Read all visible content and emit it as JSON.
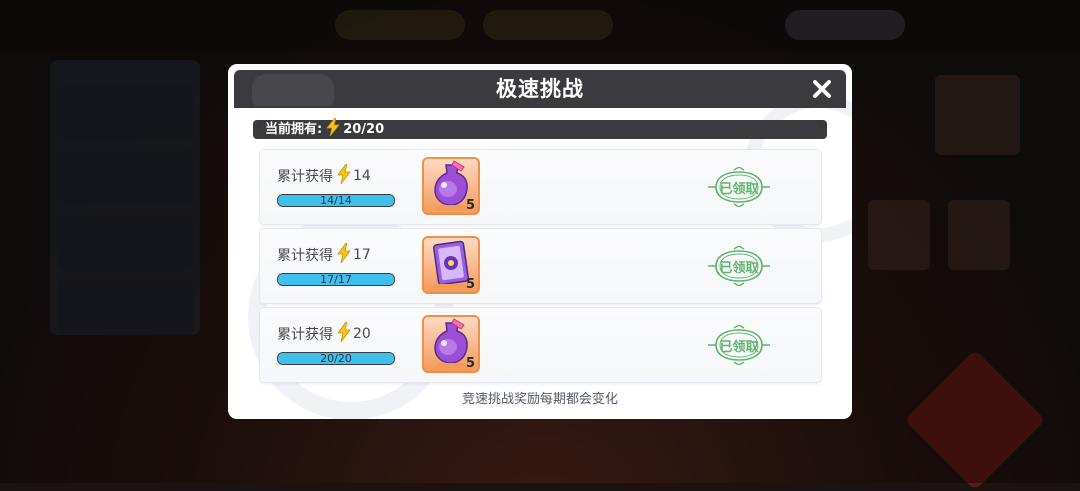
{
  "modal": {
    "title": "极速挑战",
    "owned_label": "当前拥有:",
    "owned_value": "20/20",
    "footer_note": "竞速挑战奖励每期都会变化"
  },
  "rewards": [
    {
      "req_label": "累计获得",
      "req_value": "14",
      "progress_text": "14/14",
      "progress": 1.0,
      "item_icon": "purple-potion-icon",
      "item_count": "5",
      "status": "已领取"
    },
    {
      "req_label": "累计获得",
      "req_value": "17",
      "progress_text": "17/17",
      "progress": 1.0,
      "item_icon": "purple-card-icon",
      "item_count": "5",
      "status": "已领取"
    },
    {
      "req_label": "累计获得",
      "req_value": "20",
      "progress_text": "20/20",
      "progress": 1.0,
      "item_icon": "purple-potion-icon",
      "item_count": "5",
      "status": "已领取"
    }
  ],
  "colors": {
    "header_bg": "#3b3b3f",
    "progress_fill": "#3fc0ec",
    "bolt": "#f5c518",
    "claimed_green": "#5fb46b",
    "item_border": "#f08f46"
  }
}
